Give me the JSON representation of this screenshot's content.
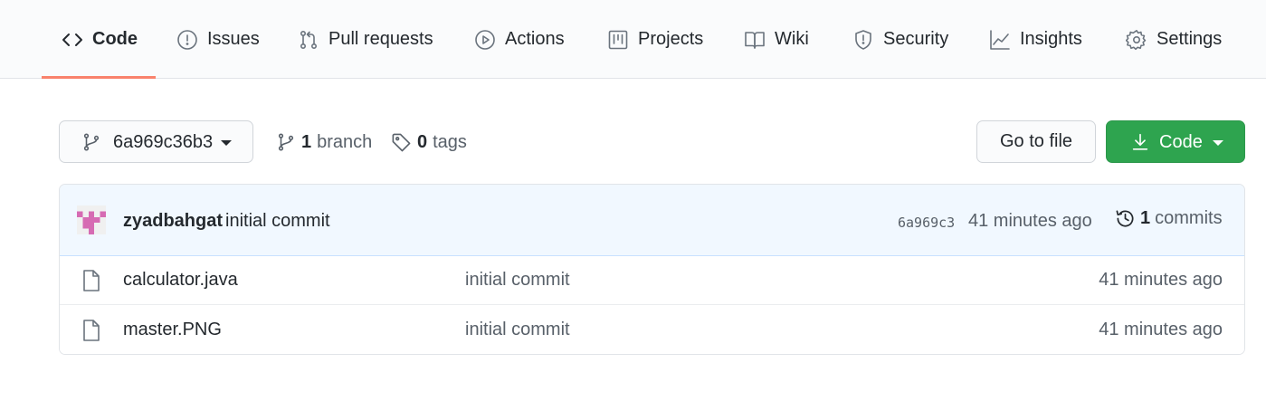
{
  "repo_nav": {
    "tabs": [
      {
        "label": "Code",
        "icon": "code-icon",
        "selected": true
      },
      {
        "label": "Issues",
        "icon": "issue-opened-icon"
      },
      {
        "label": "Pull requests",
        "icon": "git-pull-request-icon"
      },
      {
        "label": "Actions",
        "icon": "play-icon"
      },
      {
        "label": "Projects",
        "icon": "project-icon"
      },
      {
        "label": "Wiki",
        "icon": "book-icon"
      },
      {
        "label": "Security",
        "icon": "shield-icon"
      },
      {
        "label": "Insights",
        "icon": "graph-icon"
      },
      {
        "label": "Settings",
        "icon": "gear-icon"
      }
    ],
    "accent_color": "#f9826c"
  },
  "toolbar": {
    "branch_select": "6a969c36b3",
    "branch_count": "1",
    "branch_label": "branch",
    "tag_count": "0",
    "tag_label": "tags",
    "go_to_file": "Go to file",
    "code_button": "Code",
    "code_button_color": "#2ea44f"
  },
  "latest_commit": {
    "author": "zyadbahgat",
    "message": "initial commit",
    "sha": "6a969c3",
    "time": "41 minutes ago",
    "commit_count": "1",
    "commit_label": "commits"
  },
  "files": [
    {
      "name": "calculator.java",
      "message": "initial commit",
      "age": "41 minutes ago",
      "icon": "file-icon"
    },
    {
      "name": "master.PNG",
      "message": "initial commit",
      "age": "41 minutes ago",
      "icon": "file-icon"
    }
  ]
}
